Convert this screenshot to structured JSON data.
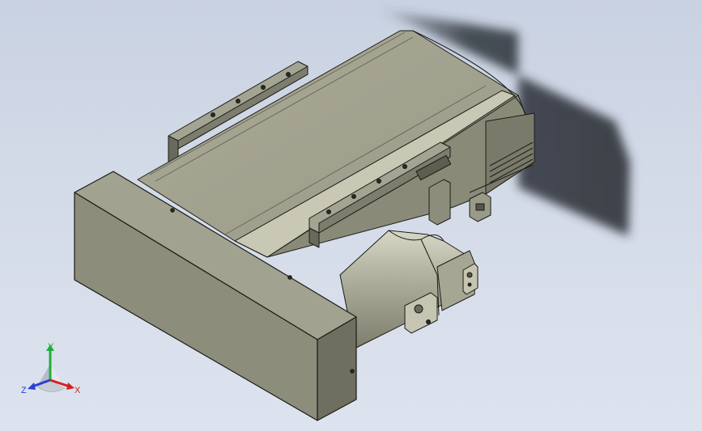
{
  "viewport": {
    "background_top": "#c9d2e2",
    "background_bottom": "#dde3ee"
  },
  "model": {
    "body_color": "#8f8f7e",
    "face_light": "#b3b3a0",
    "face_dark": "#6f6f60",
    "edge_color": "#1c1c18"
  },
  "triad": {
    "x_label": "X",
    "y_label": "Y",
    "z_label": "Z",
    "x_color": "#d22020",
    "y_color": "#1fae3a",
    "z_color": "#2a3fd8"
  }
}
